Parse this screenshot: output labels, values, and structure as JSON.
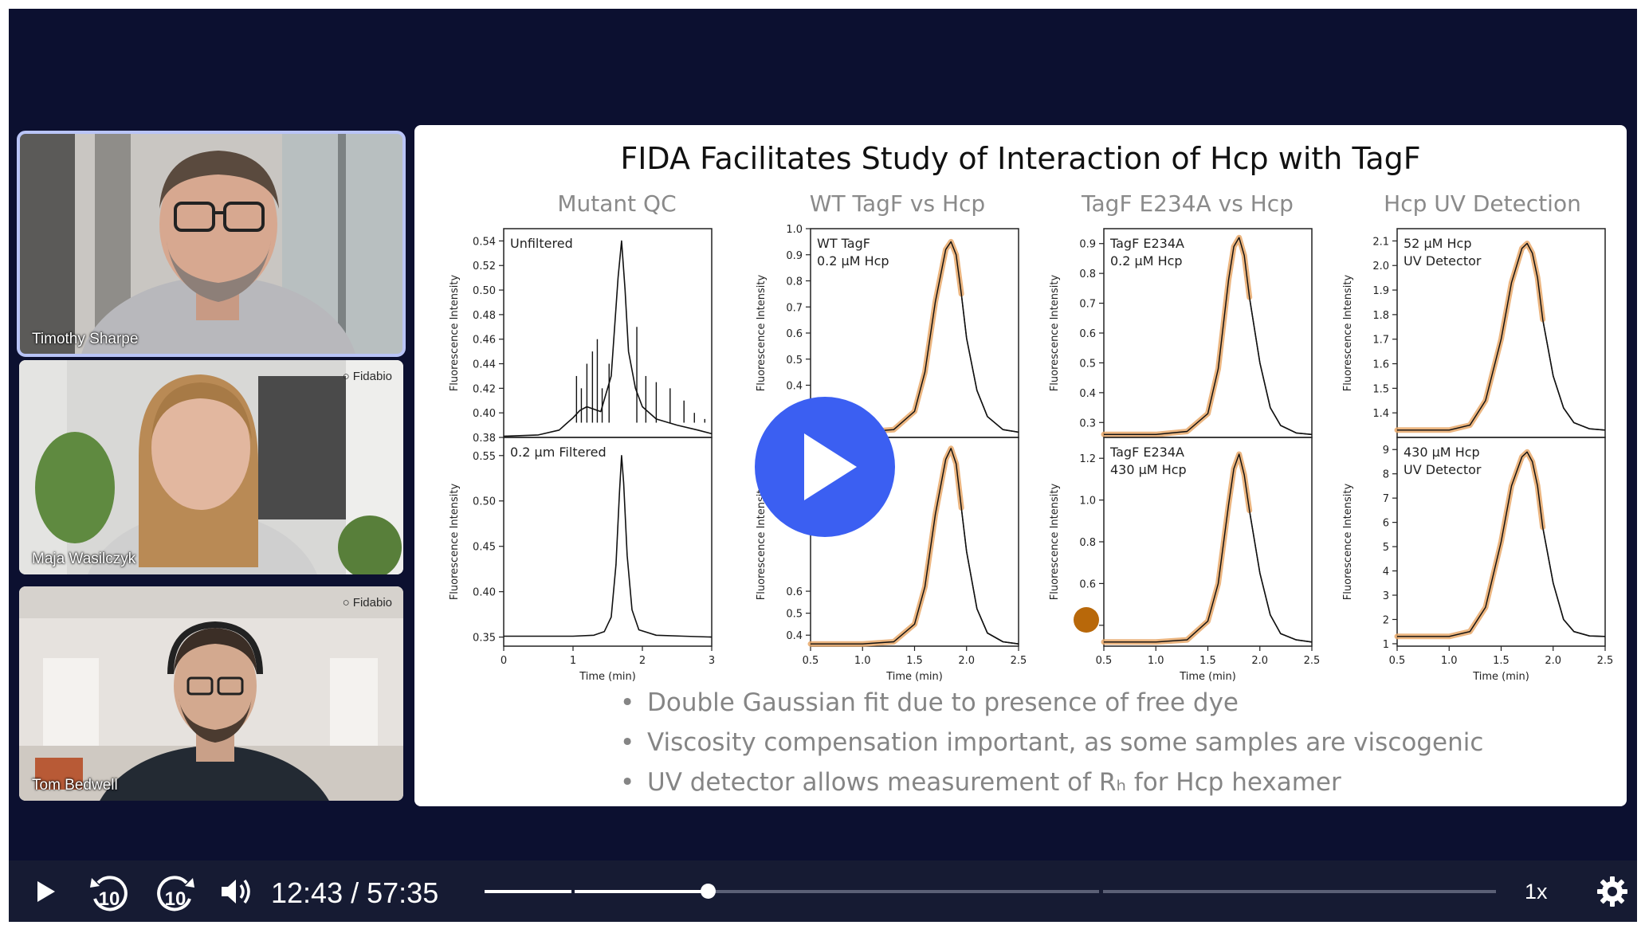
{
  "participants": [
    {
      "name": "Timothy Sharpe",
      "active": true,
      "brand": ""
    },
    {
      "name": "Maja Wasilczyk",
      "active": false,
      "brand": "Fidabio"
    },
    {
      "name": "Tom Bedwell",
      "active": false,
      "brand": "Fidabio"
    }
  ],
  "slide": {
    "title": "FIDA Facilitates Study of Interaction of Hcp with TagF",
    "bullets": [
      "Double Gaussian fit due to presence of free dye",
      "Viscosity compensation important, as some samples are viscogenic",
      "UV detector allows measurement of Rₕ for Hcp hexamer"
    ]
  },
  "chart_data": [
    {
      "type": "line",
      "panel_title": "Mutant QC",
      "annotation": "Unfiltered",
      "xlabel": "",
      "ylabel": "Fluorescence Intensity",
      "xlim": [
        0,
        3
      ],
      "ylim": [
        0.38,
        0.55
      ],
      "xticks": [],
      "yticks": [
        "0.38",
        "0.40",
        "0.42",
        "0.44",
        "0.46",
        "0.48",
        "0.50",
        "0.52",
        "0.54"
      ],
      "series": [
        {
          "x": [
            0,
            0.5,
            0.8,
            0.9,
            1.0,
            1.1,
            1.2,
            1.4,
            1.55,
            1.65,
            1.7,
            1.75,
            1.8,
            1.9,
            2.0,
            2.2,
            2.5,
            2.8,
            3.0
          ],
          "y": [
            0.381,
            0.382,
            0.386,
            0.391,
            0.396,
            0.402,
            0.405,
            0.401,
            0.43,
            0.51,
            0.54,
            0.5,
            0.45,
            0.42,
            0.405,
            0.395,
            0.39,
            0.386,
            0.383
          ]
        }
      ]
    },
    {
      "type": "line",
      "panel_title": "",
      "annotation": "0.2 µm Filtered",
      "xlabel": "Time (min)",
      "ylabel": "Fluorescence Intensity",
      "xlim": [
        0,
        3
      ],
      "ylim": [
        0.34,
        0.57
      ],
      "xticks": [
        "0",
        "1",
        "2",
        "3"
      ],
      "yticks": [
        "0.35",
        "0.40",
        "0.45",
        "0.50",
        "0.55"
      ],
      "series": [
        {
          "x": [
            0,
            0.5,
            1.0,
            1.3,
            1.45,
            1.55,
            1.62,
            1.67,
            1.7,
            1.73,
            1.78,
            1.85,
            1.95,
            2.2,
            2.6,
            3.0
          ],
          "y": [
            0.351,
            0.351,
            0.351,
            0.352,
            0.356,
            0.372,
            0.43,
            0.51,
            0.55,
            0.52,
            0.44,
            0.38,
            0.358,
            0.352,
            0.351,
            0.35
          ]
        }
      ]
    },
    {
      "type": "line",
      "panel_title": "WT TagF vs Hcp",
      "annotation": "WT TagF\n0.2 µM Hcp",
      "xlabel": "",
      "ylabel": "Fluorescence Intensity",
      "xlim": [
        0.5,
        2.5
      ],
      "ylim": [
        0.2,
        1.0
      ],
      "xticks": [],
      "yticks": [
        "0.2",
        "0.3",
        "0.4",
        "0.5",
        "0.6",
        "0.7",
        "0.8",
        "0.9",
        "1.0"
      ],
      "series": [
        {
          "name": "data",
          "x": [
            0.5,
            1.0,
            1.3,
            1.5,
            1.6,
            1.7,
            1.8,
            1.85,
            1.9,
            1.95,
            2.0,
            2.1,
            2.2,
            2.35,
            2.5
          ],
          "y": [
            0.22,
            0.22,
            0.23,
            0.3,
            0.45,
            0.72,
            0.92,
            0.95,
            0.9,
            0.75,
            0.58,
            0.38,
            0.28,
            0.23,
            0.22
          ]
        },
        {
          "name": "fit",
          "x": [
            0.5,
            1.0,
            1.3,
            1.5,
            1.6,
            1.7,
            1.8,
            1.85,
            1.9,
            1.95
          ],
          "y": [
            0.22,
            0.22,
            0.23,
            0.3,
            0.45,
            0.72,
            0.92,
            0.95,
            0.9,
            0.75
          ]
        }
      ]
    },
    {
      "type": "line",
      "panel_title": "",
      "annotation": "",
      "xlabel": "Time (min)",
      "ylabel": "Fluorescence Intensity",
      "xlim": [
        0.5,
        2.5
      ],
      "ylim": [
        0.35,
        1.3
      ],
      "xticks": [
        "0.5",
        "1.0",
        "1.5",
        "2.0",
        "2.5"
      ],
      "yticks": [
        "0.4",
        "0.5",
        "0.6"
      ],
      "series": [
        {
          "name": "data",
          "x": [
            0.5,
            1.0,
            1.3,
            1.5,
            1.6,
            1.7,
            1.8,
            1.85,
            1.9,
            1.95,
            2.0,
            2.1,
            2.2,
            2.35,
            2.5
          ],
          "y": [
            0.36,
            0.36,
            0.37,
            0.45,
            0.62,
            0.95,
            1.2,
            1.25,
            1.18,
            0.98,
            0.78,
            0.52,
            0.41,
            0.37,
            0.36
          ]
        },
        {
          "name": "fit",
          "x": [
            0.5,
            1.0,
            1.3,
            1.5,
            1.6,
            1.7,
            1.8,
            1.85,
            1.9,
            1.95
          ],
          "y": [
            0.36,
            0.36,
            0.37,
            0.45,
            0.62,
            0.95,
            1.2,
            1.25,
            1.18,
            0.98
          ]
        }
      ]
    },
    {
      "type": "line",
      "panel_title": "TagF E234A vs Hcp",
      "annotation": "TagF E234A\n0.2 µM Hcp",
      "xlabel": "",
      "ylabel": "Fluorescence Intensity",
      "xlim": [
        0.5,
        2.5
      ],
      "ylim": [
        0.25,
        0.95
      ],
      "xticks": [],
      "yticks": [
        "0.3",
        "0.4",
        "0.5",
        "0.6",
        "0.7",
        "0.8",
        "0.9"
      ],
      "series": [
        {
          "name": "data",
          "x": [
            0.5,
            1.0,
            1.3,
            1.5,
            1.6,
            1.7,
            1.75,
            1.8,
            1.85,
            1.9,
            2.0,
            2.1,
            2.2,
            2.35,
            2.5
          ],
          "y": [
            0.26,
            0.26,
            0.27,
            0.33,
            0.48,
            0.78,
            0.89,
            0.92,
            0.86,
            0.72,
            0.5,
            0.35,
            0.29,
            0.265,
            0.26
          ]
        },
        {
          "name": "fit",
          "x": [
            0.5,
            1.0,
            1.3,
            1.5,
            1.6,
            1.7,
            1.75,
            1.8,
            1.85,
            1.9
          ],
          "y": [
            0.26,
            0.26,
            0.27,
            0.33,
            0.48,
            0.78,
            0.89,
            0.92,
            0.86,
            0.72
          ]
        }
      ]
    },
    {
      "type": "line",
      "panel_title": "",
      "annotation": "TagF E234A\n430 µM Hcp",
      "xlabel": "Time (min)",
      "ylabel": "Fluorescence Intensity",
      "xlim": [
        0.5,
        2.5
      ],
      "ylim": [
        0.3,
        1.3
      ],
      "xticks": [
        "0.5",
        "1.0",
        "1.5",
        "2.0",
        "2.5"
      ],
      "yticks": [
        "0.4",
        "0.6",
        "0.8",
        "1.0",
        "1.2"
      ],
      "series": [
        {
          "name": "data",
          "x": [
            0.5,
            1.0,
            1.3,
            1.5,
            1.6,
            1.7,
            1.75,
            1.8,
            1.85,
            1.9,
            2.0,
            2.1,
            2.2,
            2.35,
            2.5
          ],
          "y": [
            0.32,
            0.32,
            0.33,
            0.42,
            0.6,
            0.98,
            1.15,
            1.22,
            1.12,
            0.95,
            0.65,
            0.45,
            0.36,
            0.33,
            0.32
          ]
        },
        {
          "name": "fit",
          "x": [
            0.5,
            1.0,
            1.3,
            1.5,
            1.6,
            1.7,
            1.75,
            1.8,
            1.85,
            1.9
          ],
          "y": [
            0.32,
            0.32,
            0.33,
            0.42,
            0.6,
            0.98,
            1.15,
            1.22,
            1.12,
            0.95
          ]
        }
      ]
    },
    {
      "type": "line",
      "panel_title": "Hcp UV Detection",
      "annotation": "52 µM Hcp\nUV Detector",
      "xlabel": "",
      "ylabel": "Fluorescence Intensity",
      "xlim": [
        0.5,
        2.5
      ],
      "ylim": [
        1.3,
        2.15
      ],
      "xticks": [],
      "yticks": [
        "1.4",
        "1.5",
        "1.6",
        "1.7",
        "1.8",
        "1.9",
        "2.0",
        "2.1"
      ],
      "series": [
        {
          "name": "data",
          "x": [
            0.5,
            1.0,
            1.2,
            1.35,
            1.5,
            1.6,
            1.7,
            1.75,
            1.8,
            1.85,
            1.9,
            2.0,
            2.1,
            2.2,
            2.35,
            2.5
          ],
          "y": [
            1.33,
            1.33,
            1.35,
            1.45,
            1.7,
            1.93,
            2.07,
            2.09,
            2.05,
            1.95,
            1.78,
            1.55,
            1.42,
            1.36,
            1.335,
            1.33
          ]
        },
        {
          "name": "fit",
          "x": [
            0.5,
            1.0,
            1.2,
            1.35,
            1.5,
            1.6,
            1.7,
            1.75,
            1.8,
            1.85,
            1.9
          ],
          "y": [
            1.33,
            1.33,
            1.35,
            1.45,
            1.7,
            1.93,
            2.07,
            2.09,
            2.05,
            1.95,
            1.78
          ]
        }
      ]
    },
    {
      "type": "line",
      "panel_title": "",
      "annotation": "430 µM Hcp\nUV Detector",
      "xlabel": "Time (min)",
      "ylabel": "Fluorescence Intensity",
      "xlim": [
        0.5,
        2.5
      ],
      "ylim": [
        0.9,
        9.5
      ],
      "xticks": [
        "0.5",
        "1.0",
        "1.5",
        "2.0",
        "2.5"
      ],
      "yticks": [
        "1",
        "2",
        "3",
        "4",
        "5",
        "6",
        "7",
        "8",
        "9"
      ],
      "series": [
        {
          "name": "data",
          "x": [
            0.5,
            1.0,
            1.2,
            1.35,
            1.5,
            1.6,
            1.7,
            1.75,
            1.8,
            1.85,
            1.9,
            2.0,
            2.1,
            2.2,
            2.35,
            2.5
          ],
          "y": [
            1.3,
            1.3,
            1.5,
            2.5,
            5.2,
            7.5,
            8.7,
            8.9,
            8.5,
            7.5,
            5.8,
            3.5,
            2.0,
            1.5,
            1.32,
            1.3
          ]
        },
        {
          "name": "fit",
          "x": [
            0.5,
            1.0,
            1.2,
            1.35,
            1.5,
            1.6,
            1.7,
            1.75,
            1.8,
            1.85,
            1.9
          ],
          "y": [
            1.3,
            1.3,
            1.5,
            2.5,
            5.2,
            7.5,
            8.7,
            8.9,
            8.5,
            7.5,
            5.8
          ]
        }
      ]
    }
  ],
  "player": {
    "current_time": "12:43",
    "separator": "/",
    "duration": "57:35",
    "speed": "1x",
    "progress": 0.221,
    "icons": {
      "play": "play-icon",
      "rewind": "rewind-10-icon",
      "forward": "forward-10-icon",
      "volume": "volume-icon",
      "settings": "gear-icon",
      "big_play": "big-play-icon"
    },
    "rewind_label": "10",
    "forward_label": "10"
  },
  "colors": {
    "accent": "#3b5ff2",
    "background": "#0c1030",
    "controls": "#161b33",
    "fit": "#e8a86a",
    "highlight": "#b9c4f7",
    "marker": "#b8680a"
  }
}
